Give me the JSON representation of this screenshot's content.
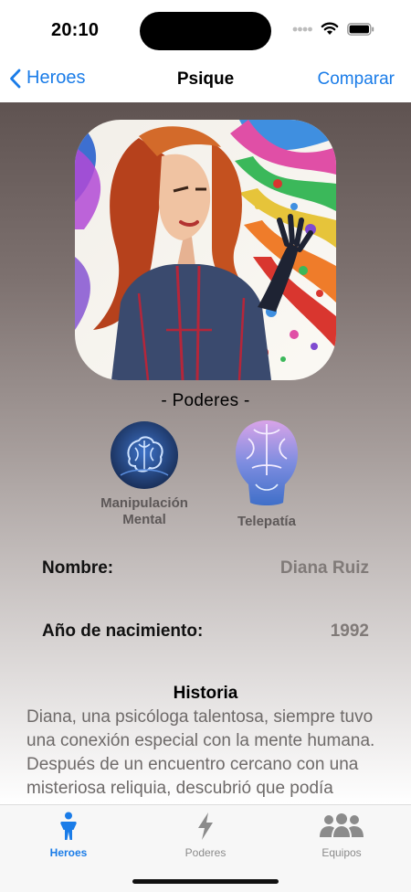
{
  "status": {
    "time": "20:10"
  },
  "nav": {
    "back_label": "Heroes",
    "title": "Psique",
    "right_label": "Comparar"
  },
  "hero": {
    "image_icon": "hero-portrait"
  },
  "powers": {
    "section_title": "- Poderes -",
    "items": [
      {
        "label": "Manipulación Mental",
        "icon": "brain-circle-icon"
      },
      {
        "label": "Telepatía",
        "icon": "head-brain-icon"
      }
    ]
  },
  "info": {
    "name_label": "Nombre:",
    "name_value": "Diana Ruiz",
    "year_label": "Año de nacimiento:",
    "year_value": "1992"
  },
  "story": {
    "title": "Historia",
    "text": "Diana, una psicóloga talentosa, siempre tuvo una conexión especial con la mente humana. Después de un encuentro cercano con una misteriosa reliquia, descubrió que podía"
  },
  "tabs": [
    {
      "label": "Heroes",
      "icon": "person-icon",
      "active": true
    },
    {
      "label": "Poderes",
      "icon": "bolt-icon",
      "active": false
    },
    {
      "label": "Equipos",
      "icon": "group-icon",
      "active": false
    }
  ],
  "colors": {
    "accent": "#1a7ce8",
    "inactive": "#8b8b8b"
  }
}
